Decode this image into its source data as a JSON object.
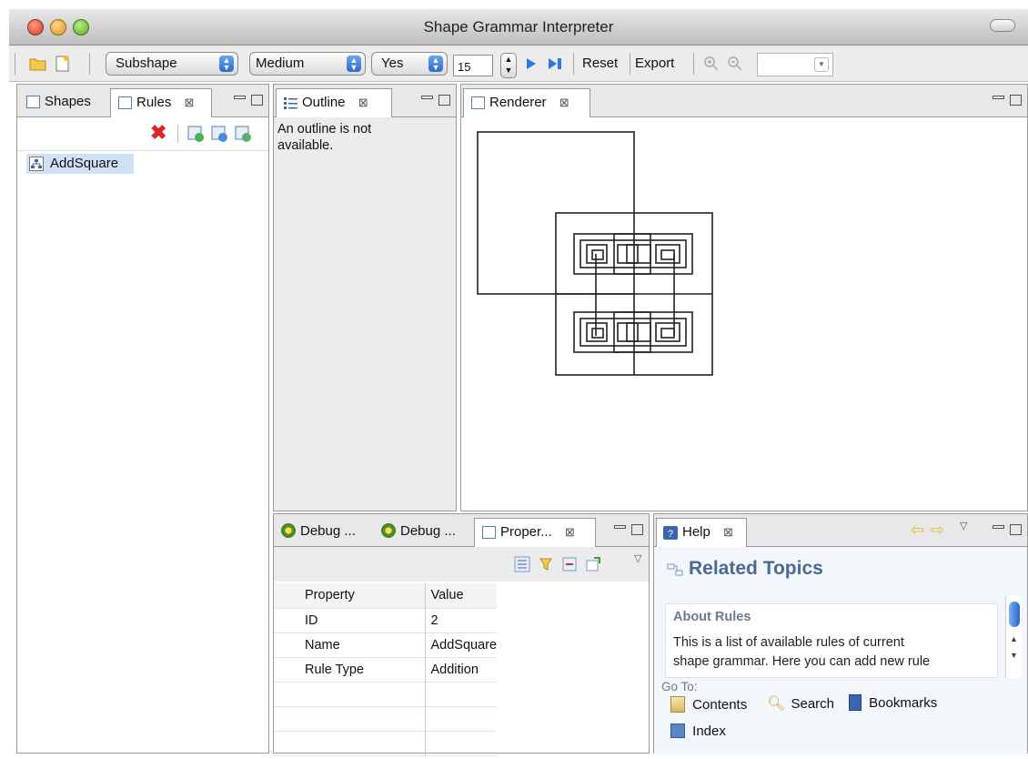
{
  "window": {
    "title": "Shape Grammar Interpreter"
  },
  "toolbar": {
    "match_mode": "Subshape",
    "size": "Medium",
    "option": "Yes",
    "steps": "15",
    "reset_label": "Reset",
    "export_label": "Export",
    "zoom_value": ""
  },
  "left_panel": {
    "tabs": [
      {
        "label": "Shapes"
      },
      {
        "label": "Rules"
      }
    ],
    "items": [
      {
        "label": "AddSquare"
      }
    ]
  },
  "outline": {
    "tab_label": "Outline",
    "message": "An outline is not available."
  },
  "renderer": {
    "tab_label": "Renderer"
  },
  "bottom_left": {
    "tabs": [
      {
        "label": "Debug ..."
      },
      {
        "label": "Debug ..."
      },
      {
        "label": "Proper..."
      }
    ],
    "columns": [
      "Property",
      "Value"
    ],
    "rows": [
      {
        "property": "ID",
        "value": "2"
      },
      {
        "property": "Name",
        "value": "AddSquare"
      },
      {
        "property": "Rule Type",
        "value": "Addition"
      }
    ]
  },
  "help": {
    "tab_label": "Help",
    "heading": "Related Topics",
    "topic_title": "About Rules",
    "topic_text_1": "This is a list of available rules of current",
    "topic_text_2": "shape grammar. Here you can add new rule",
    "goto_label": "Go To:",
    "links": {
      "contents": "Contents",
      "search": "Search",
      "bookmarks": "Bookmarks",
      "index": "Index"
    }
  },
  "colors": {
    "selection": "#cfe0f7",
    "accent": "#2d6bd0",
    "delete": "#d9262a"
  }
}
